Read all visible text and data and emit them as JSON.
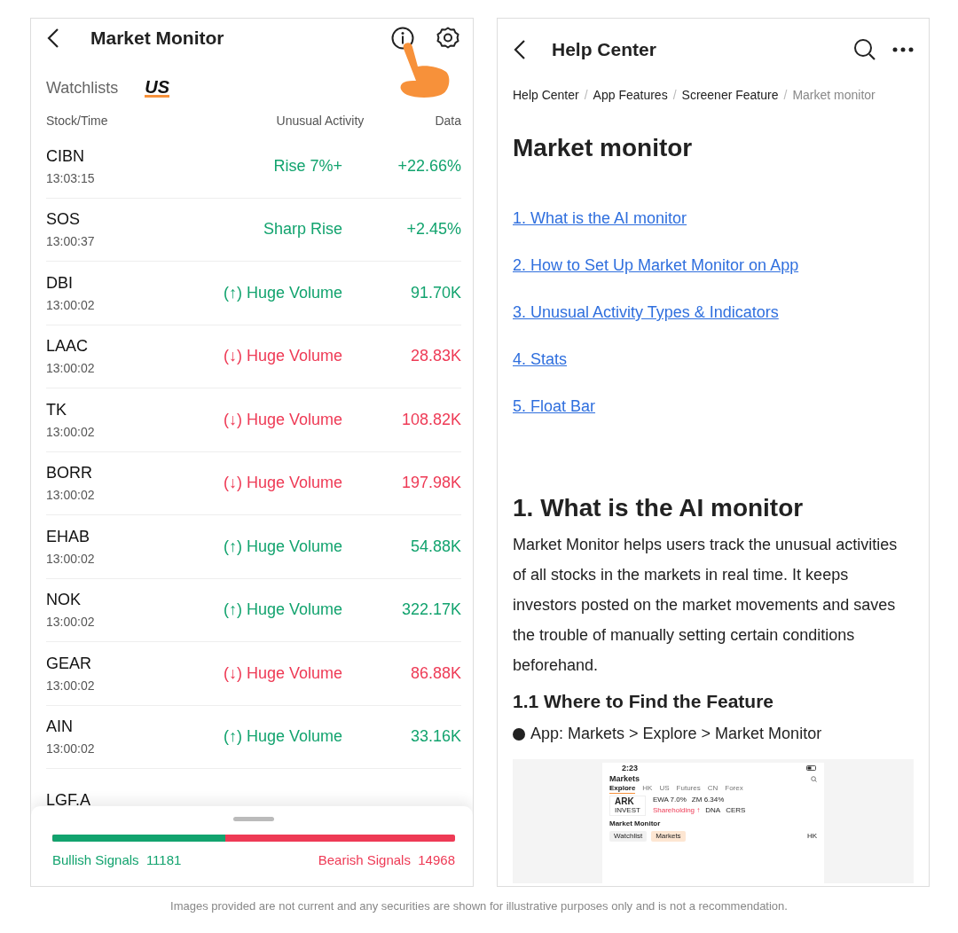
{
  "left": {
    "title": "Market Monitor",
    "tabs": [
      {
        "label": "Watchlists",
        "selected": false
      },
      {
        "label": "US",
        "selected": true
      }
    ],
    "columns": [
      "Stock/Time",
      "Unusual Activity",
      "Data"
    ],
    "rows": [
      {
        "ticker": "CIBN",
        "time": "13:03:15",
        "activity": "Rise 7%+",
        "data": "+22.66%",
        "color": "#12a36e"
      },
      {
        "ticker": "SOS",
        "time": "13:00:37",
        "activity": "Sharp Rise",
        "data": "+2.45%",
        "color": "#12a36e"
      },
      {
        "ticker": "DBI",
        "time": "13:00:02",
        "activity": "(↑) Huge Volume",
        "data": "91.70K",
        "color": "#12a36e"
      },
      {
        "ticker": "LAAC",
        "time": "13:00:02",
        "activity": "(↓) Huge Volume",
        "data": "28.83K",
        "color": "#ee3a55"
      },
      {
        "ticker": "TK",
        "time": "13:00:02",
        "activity": "(↓) Huge Volume",
        "data": "108.82K",
        "color": "#ee3a55"
      },
      {
        "ticker": "BORR",
        "time": "13:00:02",
        "activity": "(↓) Huge Volume",
        "data": "197.98K",
        "color": "#ee3a55"
      },
      {
        "ticker": "EHAB",
        "time": "13:00:02",
        "activity": "(↑) Huge Volume",
        "data": "54.88K",
        "color": "#12a36e"
      },
      {
        "ticker": "NOK",
        "time": "13:00:02",
        "activity": "(↑) Huge Volume",
        "data": "322.17K",
        "color": "#12a36e"
      },
      {
        "ticker": "GEAR",
        "time": "13:00:02",
        "activity": "(↓) Huge Volume",
        "data": "86.88K",
        "color": "#ee3a55"
      },
      {
        "ticker": "AIN",
        "time": "13:00:02",
        "activity": "(↑) Huge Volume",
        "data": "33.16K",
        "color": "#12a36e"
      },
      {
        "ticker": "LGF.A"
      }
    ],
    "signals": {
      "level": 0.43,
      "bullish_label": "Bullish Signals",
      "bullish_count": "11181",
      "bearish_label": "Bearish Signals",
      "bearish_count": "14968"
    }
  },
  "right": {
    "title": "Help Center",
    "breadcrumb_separator": "/",
    "breadcrumb": [
      {
        "label": "Help Center",
        "current": false
      },
      {
        "label": "App Features",
        "current": false
      },
      {
        "label": "Screener Feature",
        "current": false
      },
      {
        "label": "Market monitor",
        "current": true
      }
    ],
    "heading": "Market monitor",
    "links": [
      "1. What is the AI monitor",
      "2. How to Set Up Market Monitor on App",
      "3. Unusual Activity Types & Indicators",
      "4. Stats",
      "5. Float Bar"
    ],
    "section_title": "1. What is the AI monitor",
    "paragraph": "Market Monitor helps users track the unusual activities of all stocks in the markets in real time. It keeps investors posted on the market movements and saves the trouble of manually setting certain conditions beforehand.",
    "subsection_title": "1.1 Where to Find the Feature",
    "bullet": "App: Markets > Explore > Market Monitor",
    "app_screenshot": {
      "time": "2:23",
      "title": "Markets",
      "tabs": [
        {
          "label": "Explore",
          "selected": true
        },
        {
          "label": "HK",
          "selected": false
        },
        {
          "label": "US",
          "selected": false
        },
        {
          "label": "Futures",
          "selected": false
        },
        {
          "label": "CN",
          "selected": false
        },
        {
          "label": "Forex",
          "selected": false
        }
      ],
      "logo_text": "ARK",
      "logo_subtext": "INVEST",
      "quotes": [
        "EWA 7.0%",
        "ZM 6.34%"
      ],
      "tags": [
        "Shareholding ↑",
        "DNA",
        "CERS"
      ],
      "section": "Market Monitor",
      "chips": [
        {
          "label": "Watchlist",
          "selected": false
        },
        {
          "label": "Markets",
          "selected": true
        }
      ],
      "region": "HK"
    }
  },
  "disclaimer": "Images provided are not current and any securities are shown for illustrative purposes only and is not a recommendation."
}
